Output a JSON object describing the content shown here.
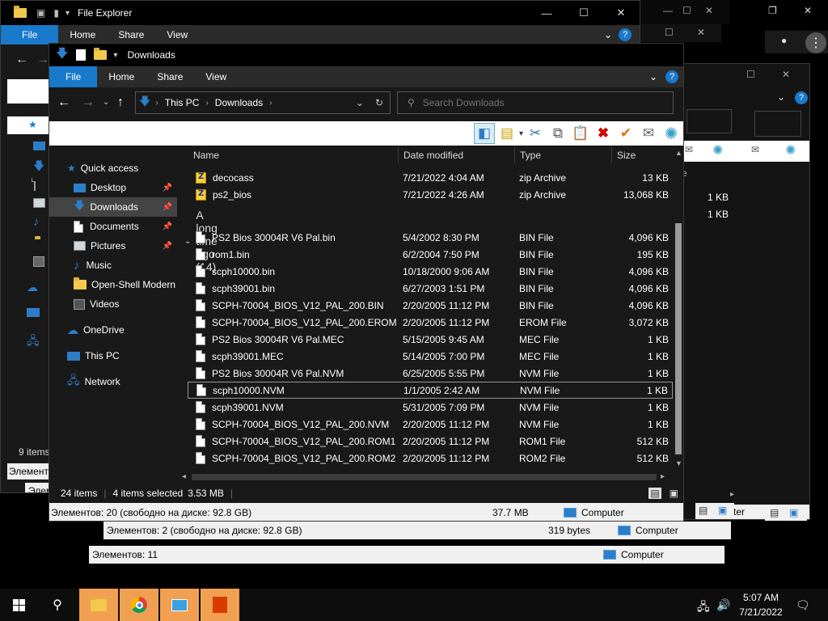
{
  "back_window_1": {
    "title": "File Explorer",
    "tabs": [
      "Home",
      "Share",
      "View"
    ],
    "file_tab": "File",
    "status_count": "9 items",
    "status_items": "Элементов",
    "status_items_2": "Элемен"
  },
  "back_window_2": {
    "status_text": "Элементов: 2 (свободно на диске: 92.8 GB)",
    "size": "319 bytes",
    "computer": "Computer",
    "sizes": [
      "1 KB",
      "1 KB"
    ],
    "fragment": "ter"
  },
  "back_window_3": {
    "status_text": "Элементов: 11",
    "computer": "Computer"
  },
  "main": {
    "address_title": "Downloads",
    "ribbon": {
      "file": "File",
      "tabs": [
        "Home",
        "Share",
        "View"
      ]
    },
    "breadcrumb": [
      "This PC",
      "Downloads"
    ],
    "search_placeholder": "Search Downloads",
    "columns": {
      "name": "Name",
      "date": "Date modified",
      "type": "Type",
      "size": "Size"
    },
    "nav": [
      {
        "label": "Quick access",
        "icon": "star-icon"
      },
      {
        "label": "Desktop",
        "icon": "desktop-icon",
        "pin": true
      },
      {
        "label": "Downloads",
        "icon": "download-arrow-icon",
        "pin": true,
        "selected": true
      },
      {
        "label": "Documents",
        "icon": "document-icon",
        "pin": true
      },
      {
        "label": "Pictures",
        "icon": "picture-icon",
        "pin": true
      },
      {
        "label": "Music",
        "icon": "music-note-icon"
      },
      {
        "label": "Open-Shell Modern",
        "icon": "folder-icon"
      },
      {
        "label": "Videos",
        "icon": "video-icon"
      },
      {
        "label": "OneDrive",
        "icon": "cloud-icon"
      },
      {
        "label": "This PC",
        "icon": "computer-icon"
      },
      {
        "label": "Network",
        "icon": "network-icon"
      }
    ],
    "recent_files": [
      {
        "name": "decocass",
        "date": "7/21/2022 4:04 AM",
        "type": "zip Archive",
        "size": "13 KB"
      },
      {
        "name": "ps2_bios",
        "date": "7/21/2022 4:26 AM",
        "type": "zip Archive",
        "size": "13,068 KB"
      }
    ],
    "group_label": "A long time ago (14)",
    "files": [
      {
        "name": "PS2 Bios 30004R V6 Pal.bin",
        "date": "5/4/2002 8:30 PM",
        "type": "BIN File",
        "size": "4,096 KB"
      },
      {
        "name": "rom1.bin",
        "date": "6/2/2004 7:50 PM",
        "type": "BIN File",
        "size": "195 KB"
      },
      {
        "name": "scph10000.bin",
        "date": "10/18/2000 9:06 AM",
        "type": "BIN File",
        "size": "4,096 KB"
      },
      {
        "name": "scph39001.bin",
        "date": "6/27/2003 1:51 PM",
        "type": "BIN File",
        "size": "4,096 KB"
      },
      {
        "name": "SCPH-70004_BIOS_V12_PAL_200.BIN",
        "date": "2/20/2005 11:12 PM",
        "type": "BIN File",
        "size": "4,096 KB"
      },
      {
        "name": "SCPH-70004_BIOS_V12_PAL_200.EROM",
        "date": "2/20/2005 11:12 PM",
        "type": "EROM File",
        "size": "3,072 KB"
      },
      {
        "name": "PS2 Bios 30004R V6 Pal.MEC",
        "date": "5/15/2005 9:45 AM",
        "type": "MEC File",
        "size": "1 KB"
      },
      {
        "name": "scph39001.MEC",
        "date": "5/14/2005 7:00 PM",
        "type": "MEC File",
        "size": "1 KB"
      },
      {
        "name": "PS2 Bios 30004R V6 Pal.NVM",
        "date": "6/25/2005 5:55 PM",
        "type": "NVM File",
        "size": "1 KB"
      },
      {
        "name": "scph10000.NVM",
        "date": "1/1/2005 2:42 AM",
        "type": "NVM File",
        "size": "1 KB",
        "selected": true
      },
      {
        "name": "scph39001.NVM",
        "date": "5/31/2005 7:09 PM",
        "type": "NVM File",
        "size": "1 KB"
      },
      {
        "name": "SCPH-70004_BIOS_V12_PAL_200.NVM",
        "date": "2/20/2005 11:12 PM",
        "type": "NVM File",
        "size": "1 KB"
      },
      {
        "name": "SCPH-70004_BIOS_V12_PAL_200.ROM1",
        "date": "2/20/2005 11:12 PM",
        "type": "ROM1 File",
        "size": "512 KB"
      },
      {
        "name": "SCPH-70004_BIOS_V12_PAL_200.ROM2",
        "date": "2/20/2005 11:12 PM",
        "type": "ROM2 File",
        "size": "512 KB"
      }
    ],
    "status": {
      "count": "24 items",
      "selected": "4 items selected",
      "sel_size": "3.53 MB"
    },
    "statusbar2": {
      "text": "Элементов: 20 (свободно на диске: 92.8 GB)",
      "size": "37.7 MB",
      "computer": "Computer"
    }
  },
  "taskbar": {
    "time": "5:07 AM",
    "date": "7/21/2022"
  },
  "colors": {
    "accent": "#1979ca",
    "background": "#191919",
    "taskbar": "#0d0d0d",
    "active_task": "#f4a460"
  }
}
